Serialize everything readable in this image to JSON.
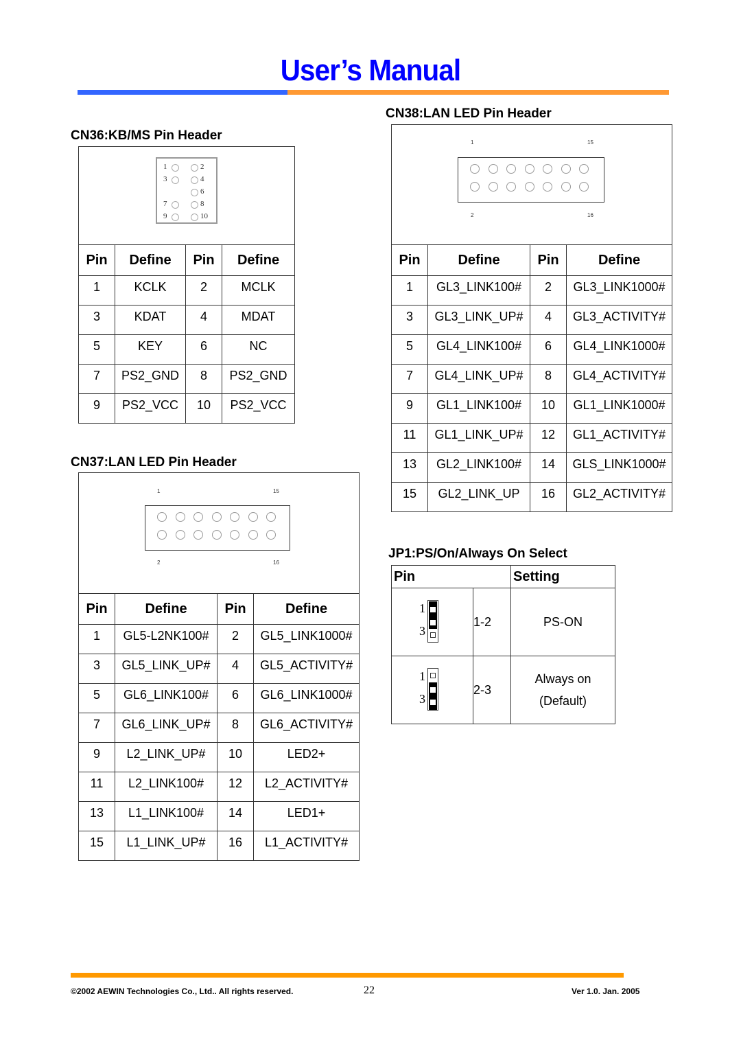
{
  "header": {
    "title": "User’s Manual",
    "bar_colors": {
      "left": "#3366ff",
      "right": "#ff9933"
    }
  },
  "cn36": {
    "title": "CN36:KB/MS Pin Header",
    "diagram": {
      "rows": [
        {
          "left_label": "1",
          "right_label": "2",
          "left_pin": true,
          "right_pin": true
        },
        {
          "left_label": "3",
          "right_label": "4",
          "left_pin": true,
          "right_pin": true
        },
        {
          "left_label": "",
          "right_label": "6",
          "left_pin": false,
          "right_pin": true
        },
        {
          "left_label": "7",
          "right_label": "8",
          "left_pin": true,
          "right_pin": true
        },
        {
          "left_label": "9",
          "right_label": "10",
          "left_pin": true,
          "right_pin": true
        }
      ]
    },
    "columns": [
      "Pin",
      "Define",
      "Pin",
      "Define"
    ],
    "rows": [
      [
        "1",
        "KCLK",
        "2",
        "MCLK"
      ],
      [
        "3",
        "KDAT",
        "4",
        "MDAT"
      ],
      [
        "5",
        "KEY",
        "6",
        "NC"
      ],
      [
        "7",
        "PS2_GND",
        "8",
        "PS2_GND"
      ],
      [
        "9",
        "PS2_VCC",
        "10",
        "PS2_VCC"
      ]
    ]
  },
  "cn37": {
    "title": "CN37:LAN LED Pin Header",
    "diagram": {
      "top_left": "1",
      "top_right": "15",
      "bottom_left": "2",
      "bottom_right": "16"
    },
    "columns": [
      "Pin",
      "Define",
      "Pin",
      "Define"
    ],
    "rows": [
      [
        "1",
        "GL5-L2NK100#",
        "2",
        "GL5_LINK1000#"
      ],
      [
        "3",
        "GL5_LINK_UP#",
        "4",
        "GL5_ACTIVITY#"
      ],
      [
        "5",
        "GL6_LINK100#",
        "6",
        "GL6_LINK1000#"
      ],
      [
        "7",
        "GL6_LINK_UP#",
        "8",
        "GL6_ACTIVITY#"
      ],
      [
        "9",
        "L2_LINK_UP#",
        "10",
        "LED2+"
      ],
      [
        "11",
        "L2_LINK100#",
        "12",
        "L2_ACTIVITY#"
      ],
      [
        "13",
        "L1_LINK100#",
        "14",
        "LED1+"
      ],
      [
        "15",
        "L1_LINK_UP#",
        "16",
        "L1_ACTIVITY#"
      ]
    ]
  },
  "cn38": {
    "title": "CN38:LAN LED Pin Header",
    "diagram": {
      "top_left": "1",
      "top_right": "15",
      "bottom_left": "2",
      "bottom_right": "16"
    },
    "columns": [
      "Pin",
      "Define",
      "Pin",
      "Define"
    ],
    "rows": [
      [
        "1",
        "GL3_LINK100#",
        "2",
        "GL3_LINK1000#"
      ],
      [
        "3",
        "GL3_LINK_UP#",
        "4",
        "GL3_ACTIVITY#"
      ],
      [
        "5",
        "GL4_LINK100#",
        "6",
        "GL4_LINK1000#"
      ],
      [
        "7",
        "GL4_LINK_UP#",
        "8",
        "GL4_ACTIVITY#"
      ],
      [
        "9",
        "GL1_LINK100#",
        "10",
        "GL1_LINK1000#"
      ],
      [
        "11",
        "GL1_LINK_UP#",
        "12",
        "GL1_ACTIVITY#"
      ],
      [
        "13",
        "GL2_LINK100#",
        "14",
        "GLS_LINK1000#"
      ],
      [
        "15",
        "GL2_LINK_UP",
        "16",
        "GL2_ACTIVITY#"
      ]
    ]
  },
  "jp1": {
    "title": "JP1:PS/On/Always On Select",
    "columns": [
      "Pin",
      "Setting"
    ],
    "rows": [
      {
        "jumper": "1-2",
        "label_top": "1",
        "label_bottom": "3",
        "setting_line1": "PS-ON",
        "setting_line2": ""
      },
      {
        "jumper": "2-3",
        "label_top": "1",
        "label_bottom": "3",
        "setting_line1": "Always on",
        "setting_line2": "(Default)"
      }
    ]
  },
  "footer": {
    "copyright": "©2002 AEWIN Technologies Co., Ltd.. All rights reserved.",
    "page_number": "22",
    "version": "Ver 1.0. Jan. 2005",
    "bar_color": "#ff9900"
  }
}
